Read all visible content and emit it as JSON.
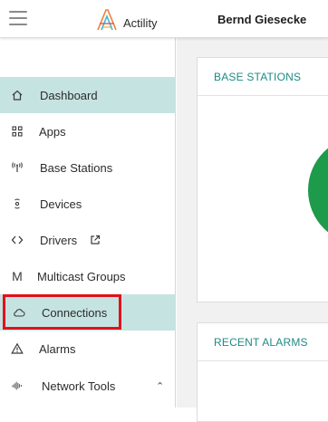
{
  "header": {
    "logo_text": "Actility",
    "user_name": "Bernd Giesecke"
  },
  "sidebar": {
    "items": [
      {
        "label": "Dashboard",
        "icon": "home-icon",
        "active": true
      },
      {
        "label": "Apps",
        "icon": "apps-grid-icon",
        "active": false
      },
      {
        "label": "Base Stations",
        "icon": "antenna-icon",
        "active": false
      },
      {
        "label": "Devices",
        "icon": "device-icon",
        "active": false
      },
      {
        "label": "Drivers",
        "icon": "code-brackets-icon",
        "active": false,
        "external": true
      },
      {
        "label": "Multicast Groups",
        "icon": "letter-m-icon",
        "active": false
      },
      {
        "label": "Connections",
        "icon": "cloud-icon",
        "active": true
      },
      {
        "label": "Alarms",
        "icon": "warning-icon",
        "active": false
      },
      {
        "label": "Network Tools",
        "icon": "signal-wave-icon",
        "active": false,
        "expandable": true
      }
    ]
  },
  "main": {
    "cards": [
      {
        "title": "BASE STATIONS"
      },
      {
        "title": "RECENT ALARMS"
      }
    ]
  },
  "colors": {
    "accent": "#1d8b86",
    "active_bg": "#c5e3e1",
    "highlight": "#e0121b",
    "chart_green": "#1e9a4b"
  }
}
